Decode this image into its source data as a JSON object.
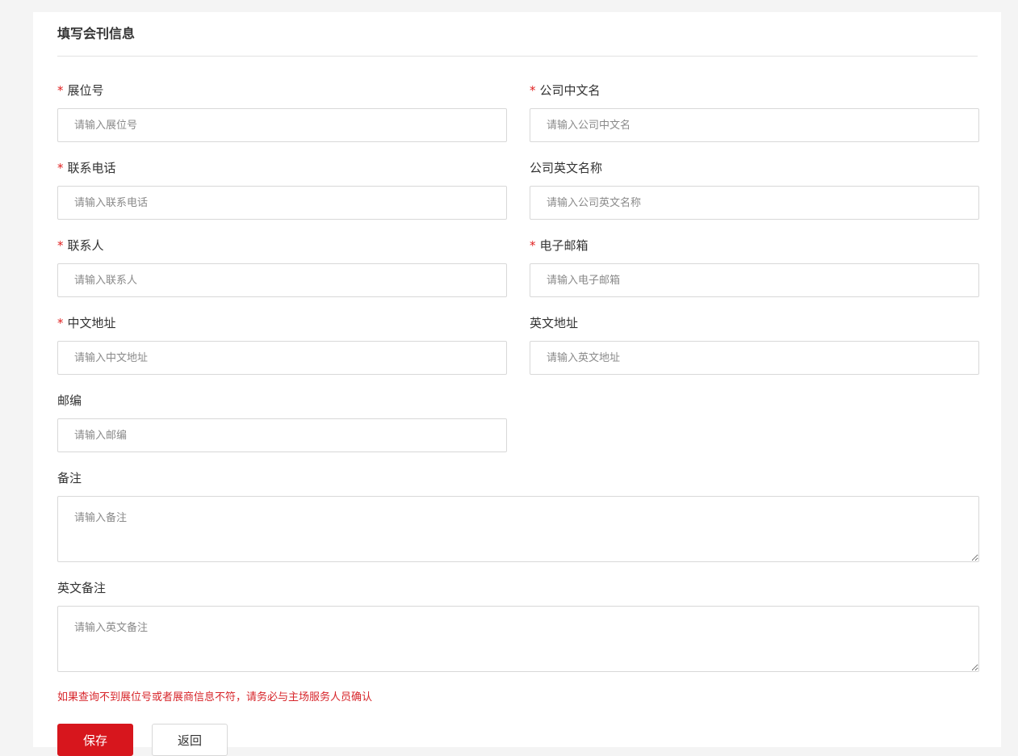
{
  "section": {
    "title": "填写会刊信息"
  },
  "form": {
    "booth_no": {
      "label": "展位号",
      "required_mark": "*",
      "placeholder": "请输入展位号"
    },
    "company_cn": {
      "label": "公司中文名",
      "required_mark": "*",
      "placeholder": "请输入公司中文名"
    },
    "phone": {
      "label": "联系电话",
      "required_mark": "*",
      "placeholder": "请输入联系电话"
    },
    "company_en": {
      "label": "公司英文名称",
      "placeholder": "请输入公司英文名称"
    },
    "contact": {
      "label": "联系人",
      "required_mark": "*",
      "placeholder": "请输入联系人"
    },
    "email": {
      "label": "电子邮箱",
      "required_mark": "*",
      "placeholder": "请输入电子邮箱"
    },
    "address_cn": {
      "label": "中文地址",
      "required_mark": "*",
      "placeholder": "请输入中文地址"
    },
    "address_en": {
      "label": "英文地址",
      "placeholder": "请输入英文地址"
    },
    "postcode": {
      "label": "邮编",
      "placeholder": "请输入邮编"
    },
    "remark": {
      "label": "备注",
      "placeholder": "请输入备注"
    },
    "remark_en": {
      "label": "英文备注",
      "placeholder": "请输入英文备注"
    }
  },
  "notice": "如果查询不到展位号或者展商信息不符，请务必与主场服务人员确认",
  "actions": {
    "save_label": "保存",
    "back_label": "返回"
  },
  "colors": {
    "required": "#e02020",
    "notice": "#d7262b",
    "primary_button": "#d7161d"
  }
}
